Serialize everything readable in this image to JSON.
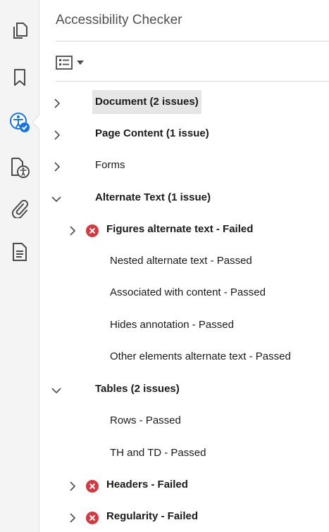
{
  "rail": {
    "icons": [
      "pages-icon",
      "bookmark-icon",
      "accessibility-checker-icon",
      "accessibility-tags-icon",
      "attachment-icon",
      "content-icon"
    ]
  },
  "panel": {
    "title": "Accessibility Checker"
  },
  "tree": {
    "document": "Document (2 issues)",
    "page_content": "Page Content (1 issue)",
    "forms": "Forms",
    "alternate_text": "Alternate Text (1 issue)",
    "figures_alt": "Figures alternate text - Failed",
    "nested_alt": "Nested alternate text - Passed",
    "associated": "Associated with content - Passed",
    "hides_annotation": "Hides annotation - Passed",
    "other_elements": "Other elements alternate text - Passed",
    "tables": "Tables (2 issues)",
    "rows": "Rows - Passed",
    "th_td": "TH and TD - Passed",
    "headers": "Headers - Failed",
    "regularity": "Regularity - Failed"
  },
  "colors": {
    "accent": "#1473e6",
    "fail": "#d7373f",
    "rail_bg": "#f4f4f4",
    "selected_bg": "#e6e6e6"
  }
}
